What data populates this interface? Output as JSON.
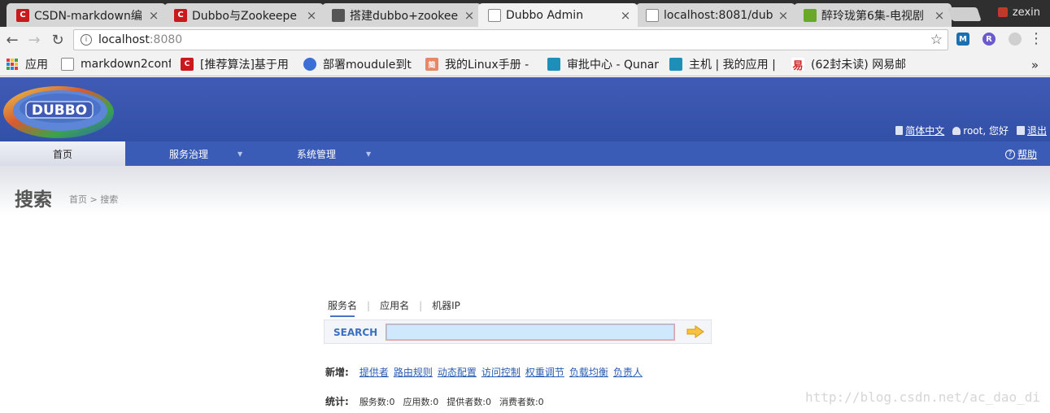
{
  "browser": {
    "tabs": [
      {
        "title": "CSDN-markdown编",
        "icon": "csdn-icon",
        "color": "#c9191e",
        "active": false
      },
      {
        "title": "Dubbo与Zookeepe",
        "icon": "csdn-icon",
        "color": "#c9191e",
        "active": false
      },
      {
        "title": "搭建dubbo+zookee",
        "icon": "avatar-icon",
        "color": "#555555",
        "active": false
      },
      {
        "title": "Dubbo Admin",
        "icon": "page-icon",
        "color": "#888888",
        "active": true
      },
      {
        "title": "localhost:8081/dub",
        "icon": "page-icon",
        "color": "#888888",
        "active": false
      },
      {
        "title": "醉玲珑第6集-电视剧",
        "icon": "video-icon",
        "color": "#6aa82a",
        "active": false
      }
    ],
    "tab_close_glyph": "×",
    "profile_name": "zexin",
    "url_host": "localhost",
    "url_port": ":8080",
    "bookmarks": [
      {
        "label": "应用",
        "icon": "apps-grid-icon"
      },
      {
        "label": "markdown2conf",
        "icon": "page-icon",
        "color": "#888888"
      },
      {
        "label": "[推荐算法]基于用",
        "icon": "csdn-icon",
        "color": "#c9191e"
      },
      {
        "label": "部署moudule到t",
        "icon": "globe-icon",
        "color": "#3b6fd6"
      },
      {
        "label": "我的Linux手册 -",
        "icon": "jianshu-icon",
        "color": "#e8866a"
      },
      {
        "label": "审批中心 - Qunar",
        "icon": "qunar-icon",
        "color": "#1e8fb8"
      },
      {
        "label": "主机 | 我的应用 |",
        "icon": "qunar-icon",
        "color": "#1e8fb8"
      },
      {
        "label": "(62封未读) 网易邮",
        "icon": "netease-icon",
        "color": "#d2262c"
      }
    ],
    "bookmarks_more": "»"
  },
  "header": {
    "logo_text": "DUBBO",
    "lang_link": "简体中文",
    "user_text": "root, 您好",
    "logout_link": "退出"
  },
  "nav": {
    "home": "首页",
    "service_governance": "服务治理",
    "system_management": "系统管理",
    "help": "帮助",
    "caret": "▼"
  },
  "page": {
    "title": "搜索",
    "breadcrumb": "首页 > 搜索"
  },
  "search": {
    "tabs": [
      "服务名",
      "应用名",
      "机器IP"
    ],
    "label": "SEARCH",
    "value": "",
    "add_label": "新增:",
    "add_links": [
      "提供者",
      "路由规则",
      "动态配置",
      "访问控制",
      "权重调节",
      "负载均衡",
      "负责人"
    ],
    "stats_label": "统计:",
    "stats": [
      "服务数:0",
      "应用数:0",
      "提供者数:0",
      "消费者数:0"
    ]
  },
  "watermark": "http://blog.csdn.net/ac_dao_di"
}
